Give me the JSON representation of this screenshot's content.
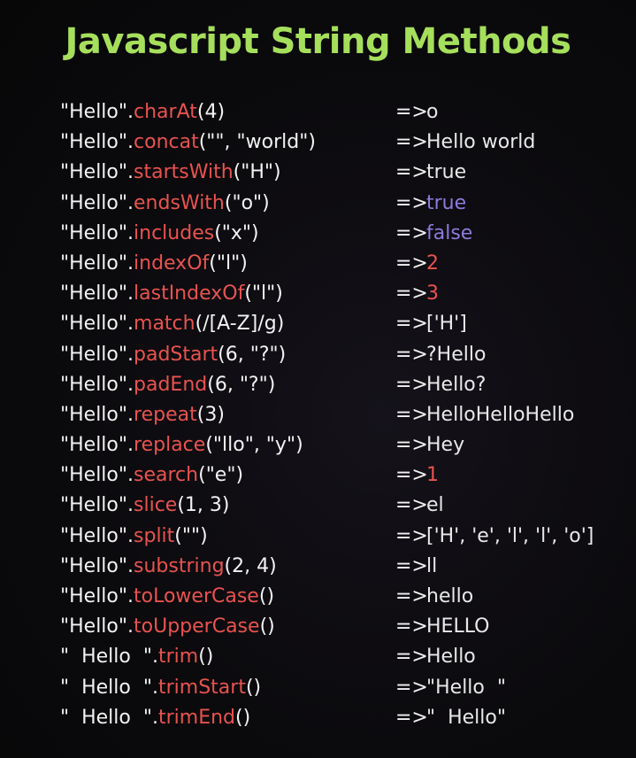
{
  "title": "Javascript String Methods",
  "colors": {
    "title": "#a6df5c",
    "method": "#e8534f",
    "text": "#f2f2f2",
    "result_default": "#e8e8e8",
    "result_boolean": "#8d7bdc",
    "result_number": "#e8534f"
  },
  "rows": [
    {
      "receiver": "\"Hello\"",
      "method": "charAt",
      "args": "(4)",
      "arrow": "=>",
      "result": "o",
      "result_color": "#e8e8e8"
    },
    {
      "receiver": "\"Hello\"",
      "method": "concat",
      "args": "(\"\", \"world\")",
      "arrow": "=>",
      "result": "Hello world",
      "result_color": "#e8e8e8"
    },
    {
      "receiver": "\"Hello\"",
      "method": "startsWith",
      "args": "(\"H\")",
      "arrow": "=>",
      "result": "true",
      "result_color": "#e8e8e8"
    },
    {
      "receiver": "\"Hello\"",
      "method": "endsWith",
      "args": "(\"o\")",
      "arrow": "=>",
      "result": "true",
      "result_color": "#8d7bdc"
    },
    {
      "receiver": "\"Hello\"",
      "method": "includes",
      "args": "(\"x\")",
      "arrow": "=>",
      "result": "false",
      "result_color": "#8d7bdc"
    },
    {
      "receiver": "\"Hello\"",
      "method": "indexOf",
      "args": "(\"l\")",
      "arrow": "=>",
      "result": "2",
      "result_color": "#e8534f"
    },
    {
      "receiver": "\"Hello\"",
      "method": "lastIndexOf",
      "args": "(\"l\")",
      "arrow": "=>",
      "result": "3",
      "result_color": "#e8534f"
    },
    {
      "receiver": "\"Hello\"",
      "method": "match",
      "args": "(/[A-Z]/g)",
      "arrow": "=>",
      "result": "['H']",
      "result_color": "#e8e8e8"
    },
    {
      "receiver": "\"Hello\"",
      "method": "padStart",
      "args": "(6, \"?\")",
      "arrow": "=>",
      "result": "?Hello",
      "result_color": "#e8e8e8"
    },
    {
      "receiver": "\"Hello\"",
      "method": "padEnd",
      "args": "(6, \"?\")",
      "arrow": "=>",
      "result": "Hello?",
      "result_color": "#e8e8e8"
    },
    {
      "receiver": "\"Hello\"",
      "method": "repeat",
      "args": "(3)",
      "arrow": "=>",
      "result": "HelloHelloHello",
      "result_color": "#e8e8e8"
    },
    {
      "receiver": "\"Hello\"",
      "method": "replace",
      "args": "(\"llo\", \"y\")",
      "arrow": "=>",
      "result": "Hey",
      "result_color": "#e8e8e8"
    },
    {
      "receiver": "\"Hello\"",
      "method": "search",
      "args": "(\"e\")",
      "arrow": "=>",
      "result": "1",
      "result_color": "#e8534f"
    },
    {
      "receiver": "\"Hello\"",
      "method": "slice",
      "args": "(1, 3)",
      "arrow": "=>",
      "result": "el",
      "result_color": "#e8e8e8"
    },
    {
      "receiver": "\"Hello\"",
      "method": "split",
      "args": "(\"\")",
      "arrow": "=>",
      "result": "['H', 'e', 'l', 'l', 'o']",
      "result_color": "#e8e8e8"
    },
    {
      "receiver": "\"Hello\"",
      "method": "substring",
      "args": "(2, 4)",
      "arrow": "=>",
      "result": "ll",
      "result_color": "#e8e8e8"
    },
    {
      "receiver": "\"Hello\"",
      "method": "toLowerCase",
      "args": "()",
      "arrow": "=>",
      "result": "hello",
      "result_color": "#e8e8e8"
    },
    {
      "receiver": "\"Hello\"",
      "method": "toUpperCase",
      "args": "()",
      "arrow": "=>",
      "result": "HELLO",
      "result_color": "#e8e8e8"
    },
    {
      "receiver": "\"  Hello  \"",
      "method": "trim",
      "args": "()",
      "arrow": "=>",
      "result": "Hello",
      "result_color": "#e8e8e8"
    },
    {
      "receiver": "\"  Hello  \"",
      "method": "trimStart",
      "args": "()",
      "arrow": "=>",
      "result": "\"Hello  \"",
      "result_color": "#e8e8e8"
    },
    {
      "receiver": "\"  Hello  \"",
      "method": "trimEnd",
      "args": "()",
      "arrow": "=>",
      "result": "\"  Hello\"",
      "result_color": "#e8e8e8"
    }
  ]
}
